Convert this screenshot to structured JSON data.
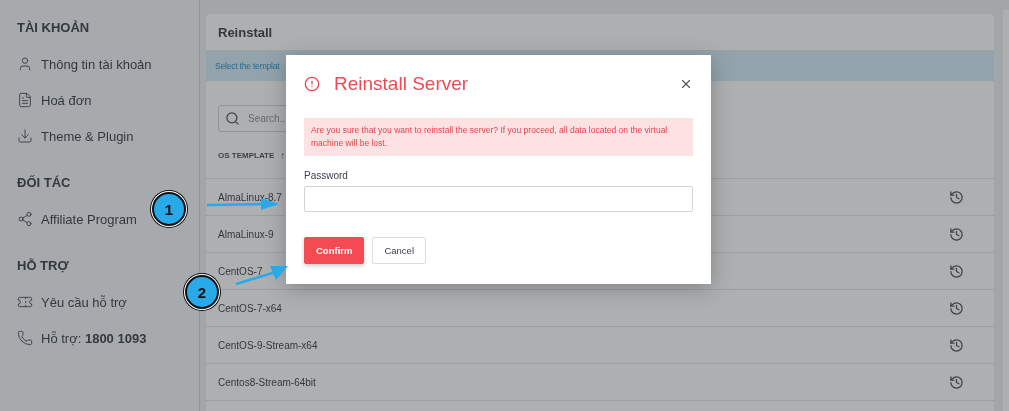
{
  "sidebar": {
    "sections": [
      {
        "title": "TÀI KHOẢN",
        "items": [
          {
            "label": "Thông tin tài khoản"
          },
          {
            "label": "Hoá đơn"
          },
          {
            "label": "Theme & Plugin"
          }
        ]
      },
      {
        "title": "ĐỐI TÁC",
        "items": [
          {
            "label": "Affiliate Program"
          }
        ]
      },
      {
        "title": "HỖ TRỢ",
        "items": [
          {
            "label": "Yêu cầu hỗ trợ"
          },
          {
            "label": "Hỗ trợ: **1800 1093**"
          }
        ]
      }
    ]
  },
  "panel": {
    "title": "Reinstall",
    "notice": "Select the templat",
    "search": {
      "placeholder": "Search..."
    },
    "table": {
      "columns": [
        "OS TEMPLATE"
      ],
      "sort": "↑",
      "rows": [
        "AlmaLinux-8.7",
        "AlmaLinux-9",
        "CentOS-7",
        "CentOS-7-x64",
        "CentOS-9-Stream-x64",
        "Centos8-Stream-64bit"
      ]
    }
  },
  "modal": {
    "title": "Reinstall Server",
    "warning": "Are you sure that you want to reinstall the server? If you proceed, all data located on the virtual machine will be lost.",
    "password_label": "Password",
    "buttons": [
      {
        "label": "Confirm",
        "kind": "primary"
      },
      {
        "label": "Cancel",
        "kind": "secondary"
      }
    ]
  },
  "annotations": [
    {
      "label": "1"
    },
    {
      "label": "2"
    }
  ]
}
